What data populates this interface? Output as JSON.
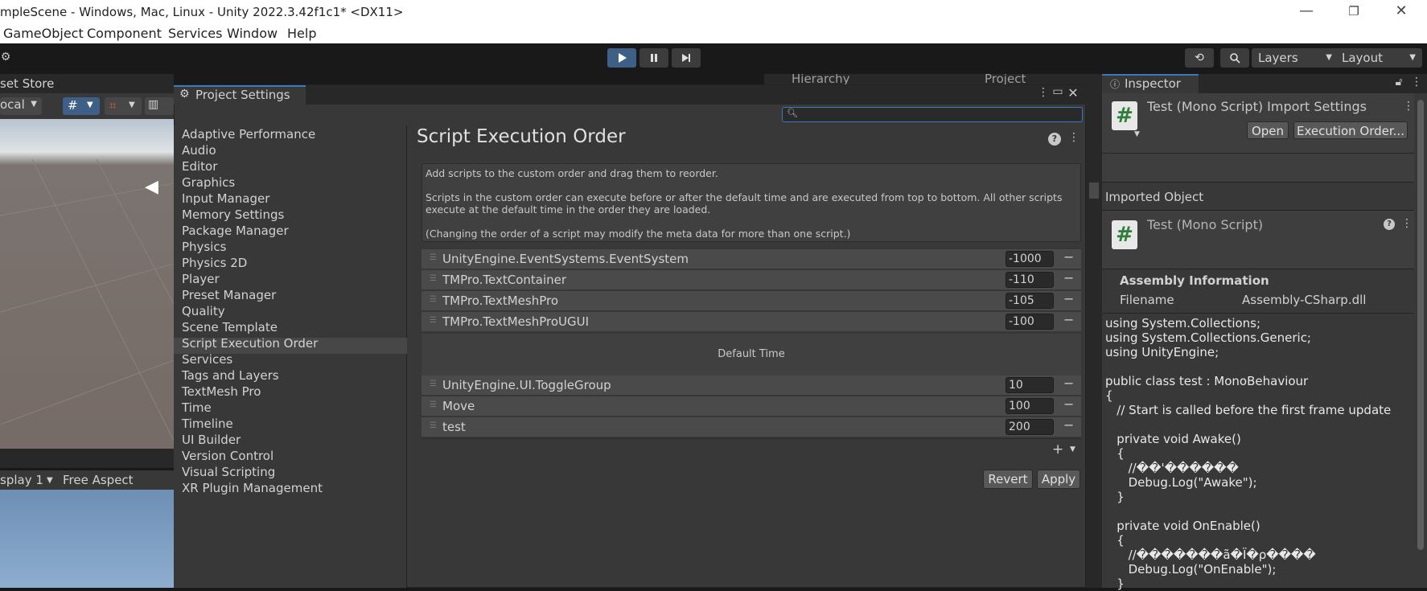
{
  "window": {
    "title": "mpleScene - Windows, Mac, Linux - Unity 2022.3.42f1c1* <DX11>",
    "minimize": "—",
    "restore": "❐",
    "close": "✕"
  },
  "menu": [
    "GameObject",
    "Component",
    "Services",
    "Window",
    "Help"
  ],
  "toolbar": {
    "play_icon": "play-icon",
    "pause_icon": "pause-icon",
    "step_icon": "step-icon",
    "layers": "Layers",
    "layout": "Layout"
  },
  "scene": {
    "tab_label": "set Store",
    "local_dropdown": "ocal",
    "display": "splay 1",
    "aspect": "Free Aspect"
  },
  "background_tabs": {
    "hierarchy": "Hierarchy",
    "project": "Project"
  },
  "project_settings": {
    "tab_label": "Project Settings",
    "search_placeholder": "",
    "categories": [
      "Adaptive Performance",
      "Audio",
      "Editor",
      "Graphics",
      "Input Manager",
      "Memory Settings",
      "Package Manager",
      "Physics",
      "Physics 2D",
      "Player",
      "Preset Manager",
      "Quality",
      "Scene Template",
      "Script Execution Order",
      "Services",
      "Tags and Layers",
      "TextMesh Pro",
      "Time",
      "Timeline",
      "UI Builder",
      "Version Control",
      "Visual Scripting",
      "XR Plugin Management"
    ],
    "selected_index": 13,
    "page_title": "Script Execution Order",
    "help_text_1": "Add scripts to the custom order and drag them to reorder.",
    "help_text_2": "Scripts in the custom order can execute before or after the default time and are executed from top to bottom. All other scripts execute at the default time in the order they are loaded.",
    "help_text_3": "(Changing the order of a script may modify the meta data for more than one script.)",
    "before_default": [
      {
        "name": "UnityEngine.EventSystems.EventSystem",
        "order": "-1000"
      },
      {
        "name": "TMPro.TextContainer",
        "order": "-110"
      },
      {
        "name": "TMPro.TextMeshPro",
        "order": "-105"
      },
      {
        "name": "TMPro.TextMeshProUGUI",
        "order": "-100"
      }
    ],
    "default_time_label": "Default Time",
    "after_default": [
      {
        "name": "UnityEngine.UI.ToggleGroup",
        "order": "10"
      },
      {
        "name": "Move",
        "order": "100"
      },
      {
        "name": "test",
        "order": "200"
      }
    ],
    "add_label": "+",
    "revert_label": "Revert",
    "apply_label": "Apply"
  },
  "inspector": {
    "tab_label": "Inspector",
    "import_title": "Test (Mono Script) Import Settings",
    "open_label": "Open",
    "execution_order_label": "Execution Order...",
    "imported_object_label": "Imported Object",
    "script_title": "Test (Mono Script)",
    "assembly_heading": "Assembly Information",
    "filename_label": "Filename",
    "filename_value": "Assembly-CSharp.dll",
    "code_lines": [
      "using System.Collections;",
      "using System.Collections.Generic;",
      "using UnityEngine;",
      "",
      "public class test : MonoBehaviour",
      "{",
      "   // Start is called before the first frame update",
      "",
      "   private void Awake()",
      "   {",
      "      //��'������",
      "      Debug.Log(\"Awake\");",
      "   }",
      "",
      "   private void OnEnable()",
      "   {",
      "      //�������ã�Ï�ρ����",
      "      Debug.Log(\"OnEnable\");",
      "   }"
    ]
  }
}
